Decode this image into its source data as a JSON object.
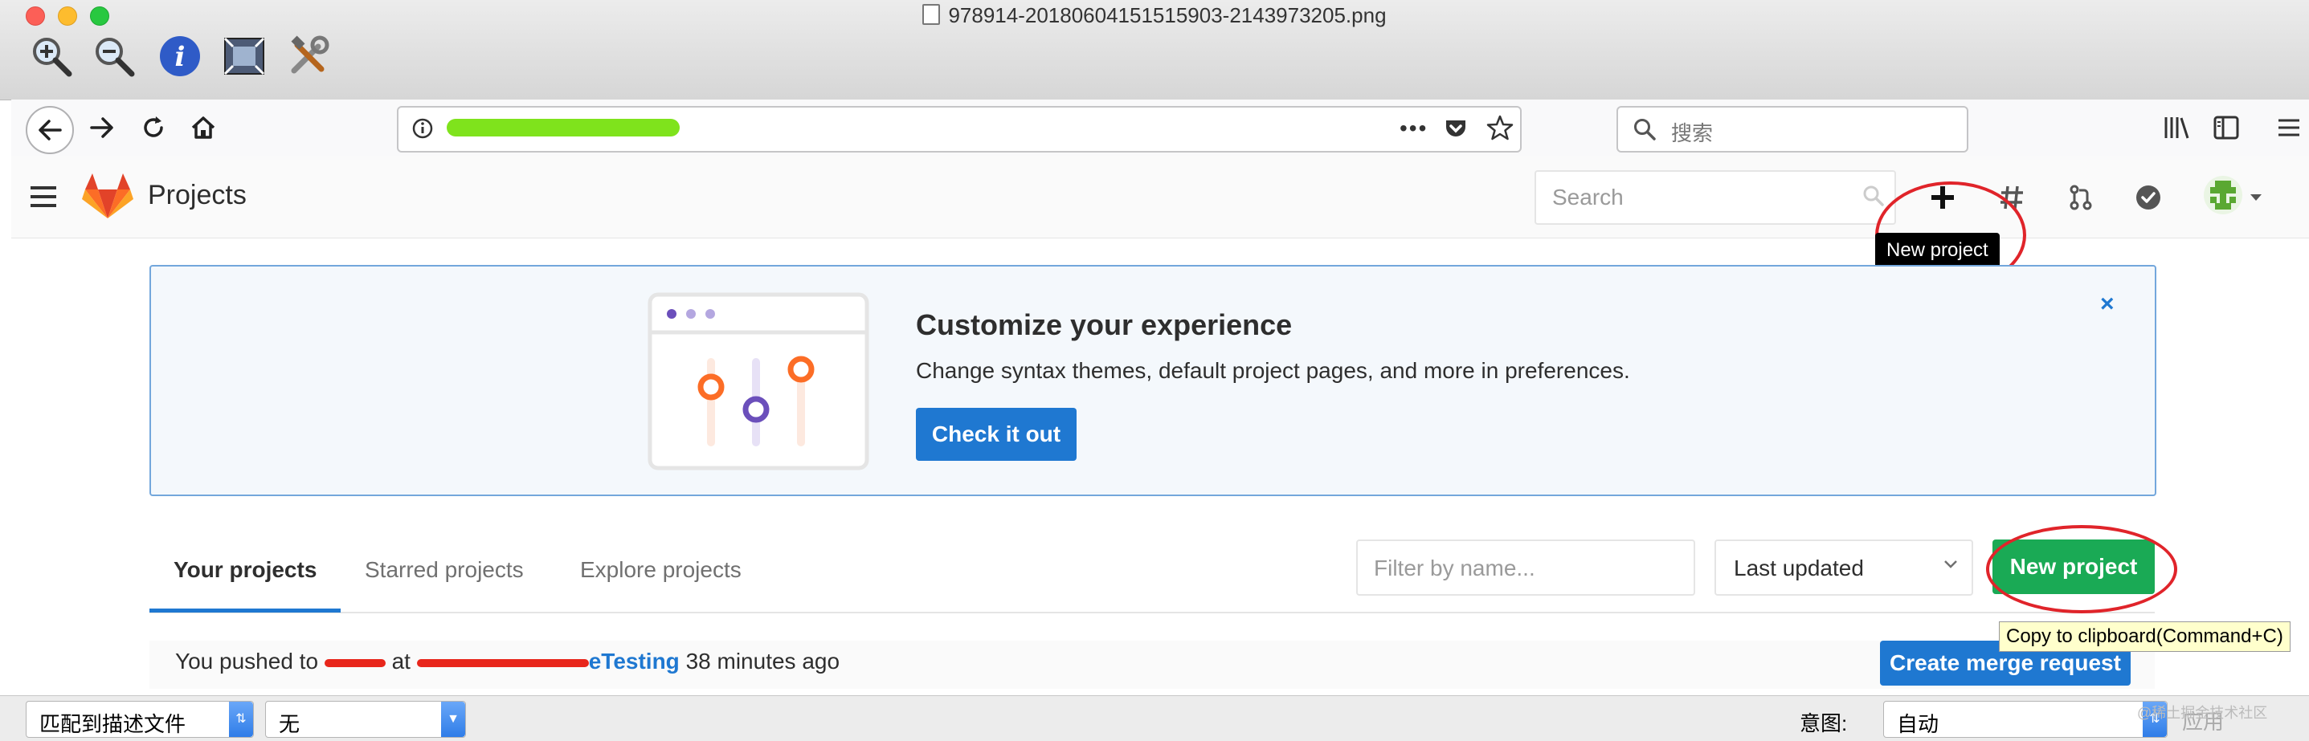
{
  "viewer": {
    "filename": "978914-20180604151515903-2143973205.png",
    "tools": [
      "zoom-in-icon",
      "zoom-out-icon",
      "info-icon",
      "fit-image-icon",
      "tools-icon"
    ]
  },
  "browser": {
    "search_placeholder": "搜索"
  },
  "gitlab": {
    "page_title": "Projects",
    "search_placeholder": "Search",
    "tooltip_new_project": "New project",
    "banner": {
      "title": "Customize your experience",
      "text": "Change syntax themes, default project pages, and more in preferences.",
      "button": "Check it out",
      "close": "×"
    },
    "tabs": [
      {
        "label": "Your projects",
        "active": true
      },
      {
        "label": "Starred projects",
        "active": false
      },
      {
        "label": "Explore projects",
        "active": false
      }
    ],
    "filter_placeholder": "Filter by name...",
    "sort_value": "Last updated",
    "new_project_button": "New project",
    "event": {
      "prefix": "You pushed to",
      "at": "at",
      "project_suffix": "eTesting",
      "time": "38 minutes ago"
    },
    "merge_button": "Create merge request",
    "clipboard_tooltip": "Copy to clipboard(Command+C)"
  },
  "bottom_panel": {
    "match_select": "匹配到描述文件",
    "profile_select": "无",
    "intent_label": "意图:",
    "intent_value": "自动",
    "apply_button": "应用",
    "watermark": "@稀土掘金技术社区"
  },
  "colors": {
    "gitlab_blue": "#1f78d1",
    "gitlab_green": "#1aaa55",
    "annotation_red": "#e0242a"
  }
}
